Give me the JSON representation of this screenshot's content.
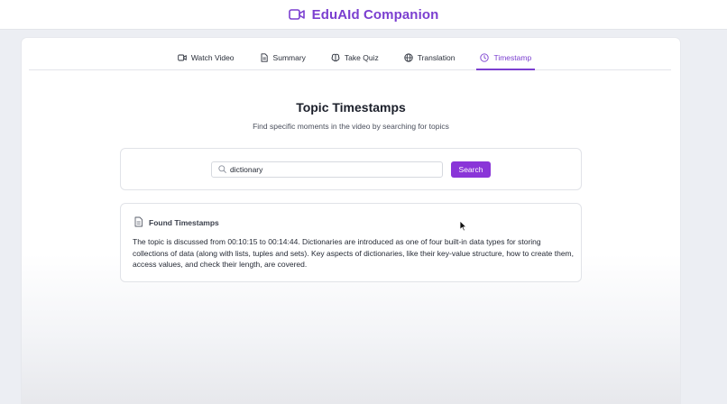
{
  "app": {
    "title": "EduAId Companion",
    "brand_color": "#7b3fd0",
    "icon": "video-camera-icon"
  },
  "tabs": [
    {
      "label": "Watch Video",
      "icon": "video-camera-icon",
      "active": false
    },
    {
      "label": "Summary",
      "icon": "document-icon",
      "active": false
    },
    {
      "label": "Take Quiz",
      "icon": "brain-icon",
      "active": false
    },
    {
      "label": "Translation",
      "icon": "globe-icon",
      "active": false
    },
    {
      "label": "Timestamp",
      "icon": "clock-icon",
      "active": true
    }
  ],
  "main": {
    "heading": "Topic Timestamps",
    "subheading": "Find specific moments in the video by searching for topics"
  },
  "search": {
    "value": "dictionary",
    "button_label": "Search",
    "button_color": "#8a35d8"
  },
  "results": {
    "title": "Found Timestamps",
    "text": "The topic is discussed from 00:10:15 to 00:14:44. Dictionaries are introduced as one of four built-in data types for storing collections of data (along with lists, tuples and sets). Key aspects of dictionaries, like their key-value structure, how to create them, access values, and check their length, are covered."
  }
}
